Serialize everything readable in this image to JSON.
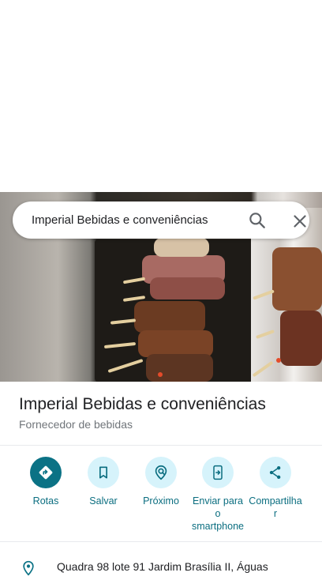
{
  "search": {
    "query": "Imperial Bebidas e conveniências"
  },
  "place": {
    "name": "Imperial Bebidas e conveniências",
    "category": "Fornecedor de bebidas"
  },
  "actions": [
    {
      "label": "Rotas",
      "icon": "directions-icon"
    },
    {
      "label": "Salvar",
      "icon": "bookmark-icon"
    },
    {
      "label": "Próximo",
      "icon": "nearby-icon"
    },
    {
      "label": "Enviar para o smartphone",
      "icon": "send-to-phone-icon"
    },
    {
      "label": "Compartilhar",
      "icon": "share-icon"
    }
  ],
  "address": {
    "text": "Quadra 98 lote 91 Jardim Brasília II, Águas"
  },
  "colors": {
    "accent": "#0b7285",
    "action_bg": "#d6f3fb",
    "action_text": "#0b6e80"
  }
}
